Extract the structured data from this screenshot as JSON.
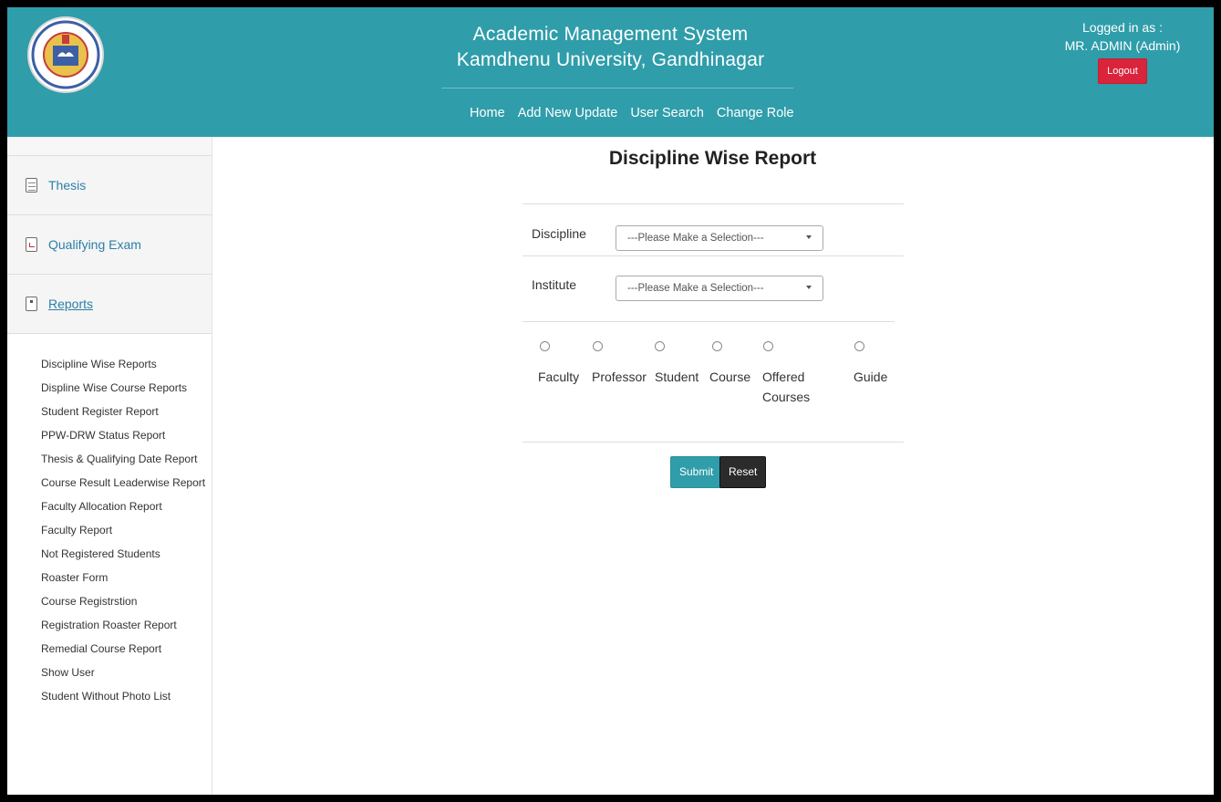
{
  "header": {
    "title_line1": "Academic Management System",
    "title_line2": "Kamdhenu University, Gandhinagar",
    "nav": [
      "Home",
      "Add New Update",
      "User Search",
      "Change Role"
    ],
    "logged_in_label": "Logged in as :",
    "user_name": "MR. ADMIN (Admin)",
    "logout_label": "Logout",
    "accent_color": "#2f9daa",
    "logout_color": "#d9243b"
  },
  "sidebar": {
    "items": [
      {
        "label": "Thesis",
        "icon": "grid-document-icon"
      },
      {
        "label": "Qualifying Exam",
        "icon": "document-icon"
      },
      {
        "label": "Reports",
        "icon": "report-icon"
      }
    ],
    "reports": [
      "Discipline Wise Reports",
      "Displine Wise Course Reports",
      "Student Register Report",
      "PPW-DRW Status Report",
      "Thesis & Qualifying Date Report",
      "Course Result Leaderwise Report",
      "Faculty Allocation Report",
      "Faculty Report",
      "Not Registered Students",
      "Roaster Form",
      "Course Registrstion",
      "Registration Roaster Report",
      "Remedial Course Report",
      "Show User",
      "Student Without Photo List"
    ]
  },
  "main": {
    "title": "Discipline Wise Report",
    "discipline_label": "Discipline",
    "discipline_value": "---Please Make a Selection---",
    "institute_label": "Institute",
    "institute_value": "---Please Make a Selection---",
    "radio_options": [
      "Faculty",
      "Professor",
      "Student",
      "Course",
      "Offered Courses",
      "Guide"
    ],
    "submit_label": "Submit",
    "reset_label": "Reset"
  }
}
